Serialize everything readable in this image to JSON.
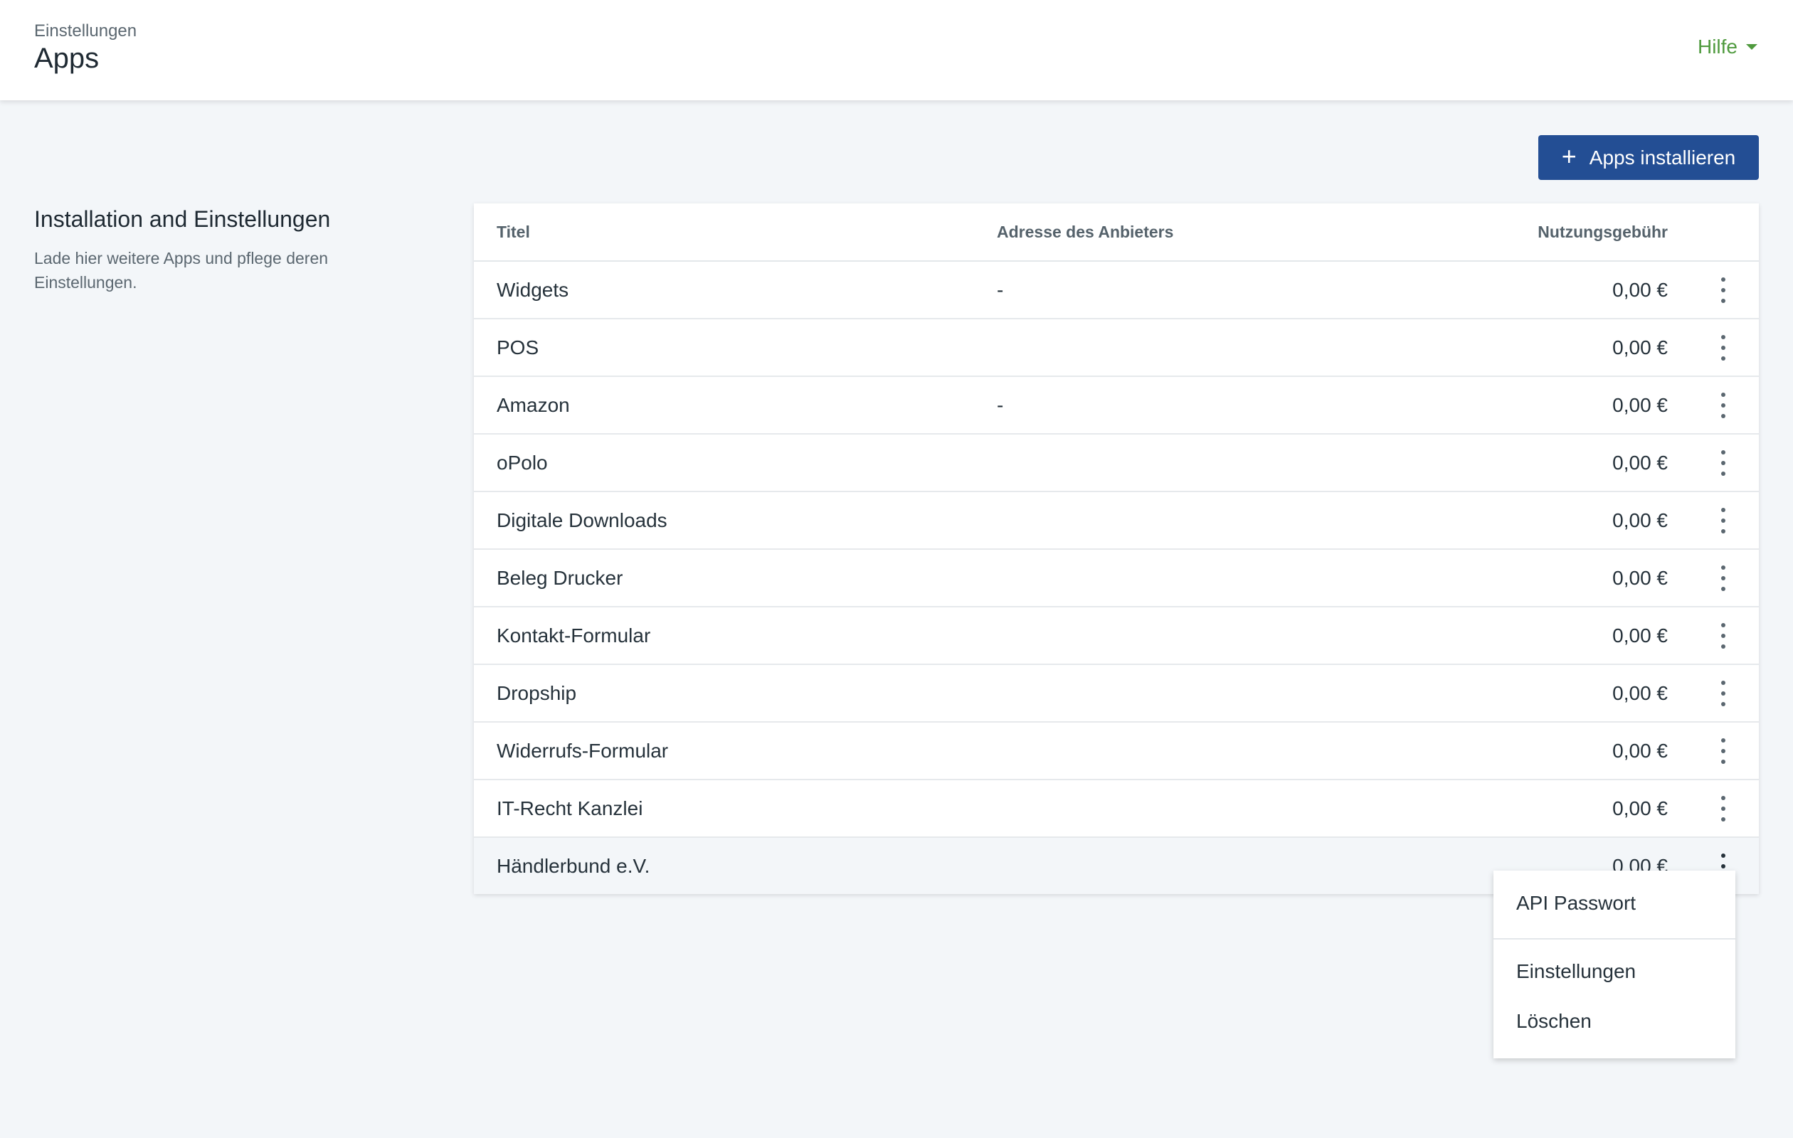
{
  "header": {
    "breadcrumb": "Einstellungen",
    "title": "Apps",
    "help_label": "Hilfe"
  },
  "toolbar": {
    "install_label": "Apps installieren",
    "install_icon": "plus-icon",
    "accent_color": "#234e94"
  },
  "section": {
    "title": "Installation and Einstellungen",
    "description": "Lade hier weitere Apps und pflege deren Einstellungen."
  },
  "table": {
    "columns": [
      "Titel",
      "Adresse des Anbieters",
      "Nutzungsgebühr"
    ],
    "rows": [
      {
        "title": "Widgets",
        "address": "-",
        "fee": "0,00 €"
      },
      {
        "title": "POS",
        "address": "",
        "fee": "0,00 €"
      },
      {
        "title": "Amazon",
        "address": "-",
        "fee": "0,00 €"
      },
      {
        "title": "oPolo",
        "address": "",
        "fee": "0,00 €"
      },
      {
        "title": "Digitale Downloads",
        "address": "",
        "fee": "0,00 €"
      },
      {
        "title": "Beleg Drucker",
        "address": "",
        "fee": "0,00 €"
      },
      {
        "title": "Kontakt-Formular",
        "address": "",
        "fee": "0,00 €"
      },
      {
        "title": "Dropship",
        "address": "",
        "fee": "0,00 €"
      },
      {
        "title": "Widerrufs-Formular",
        "address": "",
        "fee": "0,00 €"
      },
      {
        "title": "IT-Recht Kanzlei",
        "address": "",
        "fee": "0,00 €"
      },
      {
        "title": "Händlerbund e.V.",
        "address": "",
        "fee": "0,00 €"
      }
    ]
  },
  "context_menu": {
    "items": [
      "API Passwort",
      "Einstellungen",
      "Löschen"
    ]
  }
}
